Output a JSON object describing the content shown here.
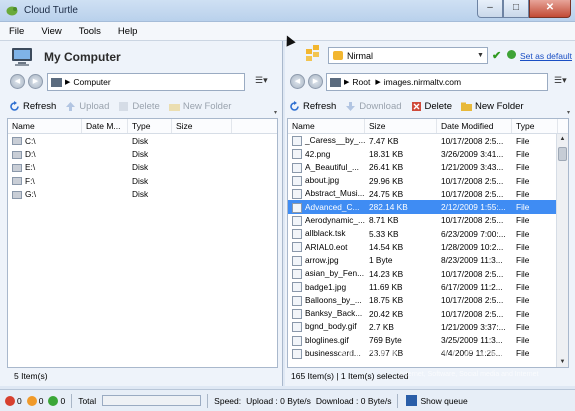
{
  "window": {
    "title": "Cloud Turtle",
    "buttons": {
      "minimize": "–",
      "maximize": "□",
      "close": "✕"
    }
  },
  "menu": [
    "File",
    "View",
    "Tools",
    "Help"
  ],
  "left": {
    "title": "My Computer",
    "path": "Computer",
    "toolbar": {
      "refresh": "Refresh",
      "upload": "Upload",
      "delete": "Delete",
      "new_folder": "New Folder"
    },
    "columns": [
      "Name",
      "Date M...",
      "Type",
      "Size"
    ],
    "rows": [
      {
        "name": "C:\\",
        "date": "",
        "type": "Disk",
        "size": ""
      },
      {
        "name": "D:\\",
        "date": "",
        "type": "Disk",
        "size": ""
      },
      {
        "name": "E:\\",
        "date": "",
        "type": "Disk",
        "size": ""
      },
      {
        "name": "F:\\",
        "date": "",
        "type": "Disk",
        "size": ""
      },
      {
        "name": "G:\\",
        "date": "",
        "type": "Disk",
        "size": ""
      }
    ],
    "status": "5 Item(s)"
  },
  "right": {
    "profile": "Nirmal",
    "set_default": "Set as default",
    "path": {
      "root": "Root",
      "folder": "images.nirmaltv.com"
    },
    "toolbar": {
      "refresh": "Refresh",
      "download": "Download",
      "delete": "Delete",
      "new_folder": "New Folder"
    },
    "columns": [
      "Name",
      "Size",
      "Date Modified",
      "Type"
    ],
    "rows": [
      {
        "name": "_Caress__by_...",
        "size": "7.47 KB",
        "date": "10/17/2008 2:5...",
        "type": "File"
      },
      {
        "name": "42.png",
        "size": "18.31 KB",
        "date": "3/26/2009 3:41...",
        "type": "File"
      },
      {
        "name": "A_Beautiful_...",
        "size": "26.41 KB",
        "date": "1/21/2009 3:43...",
        "type": "File"
      },
      {
        "name": "about.jpg",
        "size": "29.96 KB",
        "date": "10/17/2008 2:5...",
        "type": "File"
      },
      {
        "name": "Abstract_Musi...",
        "size": "24.75 KB",
        "date": "10/17/2008 2:5...",
        "type": "File"
      },
      {
        "name": "Advanced_C...",
        "size": "282.14 KB",
        "date": "2/12/2009 1:55:...",
        "type": "File"
      },
      {
        "name": "Aerodynamic_...",
        "size": "8.71 KB",
        "date": "10/17/2008 2:5...",
        "type": "File"
      },
      {
        "name": "allblack.tsk",
        "size": "5.33 KB",
        "date": "6/23/2009 7:00:...",
        "type": "File"
      },
      {
        "name": "ARIAL0.eot",
        "size": "14.54 KB",
        "date": "1/28/2009 10:2...",
        "type": "File"
      },
      {
        "name": "arrow.jpg",
        "size": "1 Byte",
        "date": "8/23/2009 11:3...",
        "type": "File"
      },
      {
        "name": "asian_by_Fen...",
        "size": "14.23 KB",
        "date": "10/17/2008 2:5...",
        "type": "File"
      },
      {
        "name": "badge1.jpg",
        "size": "11.69 KB",
        "date": "6/17/2009 11:2...",
        "type": "File"
      },
      {
        "name": "Balloons_by_...",
        "size": "18.75 KB",
        "date": "10/17/2008 2:5...",
        "type": "File"
      },
      {
        "name": "Banksy_Back...",
        "size": "20.42 KB",
        "date": "10/17/2008 2:5...",
        "type": "File"
      },
      {
        "name": "bgnd_body.gif",
        "size": "2.7 KB",
        "date": "1/21/2009 3:37:...",
        "type": "File"
      },
      {
        "name": "bloglines.gif",
        "size": "769 Byte",
        "date": "3/25/2009 11:3...",
        "type": "File"
      },
      {
        "name": "businesscard...",
        "size": "23.97 KB",
        "date": "4/4/2009 11:25...",
        "type": "File"
      }
    ],
    "selected_index": 5,
    "status": "165 Item(s)  |  1 Item(s) selected"
  },
  "bottom": {
    "queue_error": "0",
    "queue_pending": "0",
    "queue_done": "0",
    "total_label": "Total",
    "total_progress": 0,
    "speed_label": "Speed:",
    "upload": "Upload : 0 Byte/s",
    "download": "Download : 0 Byte/s",
    "show_queue": "Show queue"
  },
  "watermark": {
    "main": "NIRMALTV.COM",
    "sub": "Internet, Software, Social media and Internet"
  },
  "colors": {
    "selection": "#3f8cf3",
    "link": "#1a4fc4",
    "progress": "#37b34a"
  }
}
